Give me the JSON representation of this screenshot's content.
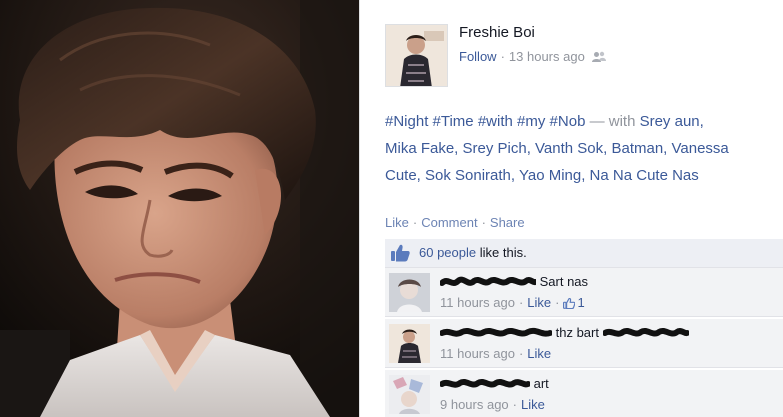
{
  "post": {
    "author": "Freshie Boi",
    "follow_label": "Follow",
    "timestamp": "13 hours ago",
    "audience_icon": "friends-icon",
    "hashtags": [
      "#Night",
      "#Time",
      "#with",
      "#my",
      "#Nob"
    ],
    "with_label": "— with",
    "tagged_line1": "Srey aun,",
    "tagged_line2": "Mika Fake, Srey Pich, Vanth Sok, Batman, Vanessa",
    "tagged_line3": "Cute, Sok Sonirath, Yao Ming, Na Na Cute Nas"
  },
  "actions": {
    "like": "Like",
    "comment": "Comment",
    "share": "Share"
  },
  "likes": {
    "count": "60 people",
    "suffix": "like this."
  },
  "comments": [
    {
      "text": "Sart nas",
      "time": "11 hours ago",
      "like_label": "Like",
      "like_count": "1"
    },
    {
      "text": "thz bart",
      "time": "11 hours ago",
      "like_label": "Like"
    },
    {
      "text": "art",
      "time": "9 hours ago",
      "like_label": "Like"
    }
  ],
  "colors": {
    "link": "#3b5998",
    "muted": "#90949c",
    "likes_bg": "#edeff4",
    "comment_bg": "#f2f3f5"
  }
}
